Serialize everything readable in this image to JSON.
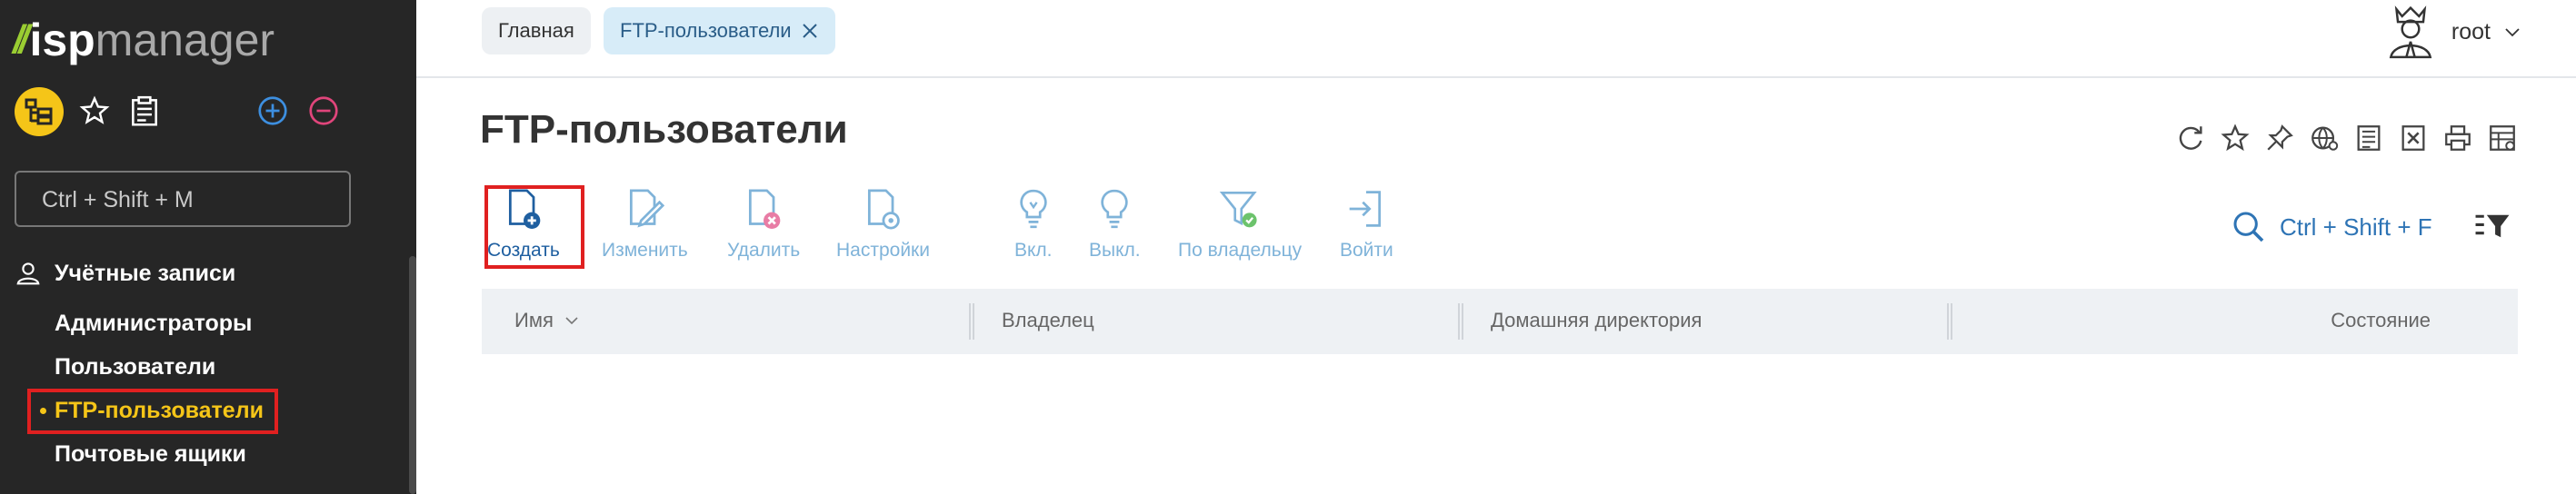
{
  "logo": {
    "part1": "isp",
    "part2": "manager"
  },
  "sidebar": {
    "search_placeholder": "Ctrl + Shift + M",
    "section_title": "Учётные записи",
    "items": [
      {
        "label": "Администраторы"
      },
      {
        "label": "Пользователи"
      },
      {
        "label": "FTP-пользователи",
        "active": true
      },
      {
        "label": "Почтовые ящики"
      }
    ]
  },
  "tabs": [
    {
      "label": "Главная"
    },
    {
      "label": "FTP-пользователи",
      "active": true
    }
  ],
  "user": {
    "name": "root"
  },
  "page": {
    "title": "FTP-пользователи"
  },
  "toolbar": {
    "create": "Создать",
    "edit": "Изменить",
    "delete": "Удалить",
    "settings": "Настройки",
    "on": "Вкл.",
    "off": "Выкл.",
    "by_owner": "По владельцу",
    "login": "Войти"
  },
  "search": {
    "hint": "Ctrl + Shift + F"
  },
  "table": {
    "columns": [
      "Имя",
      "Владелец",
      "Домашняя директория",
      "Состояние"
    ]
  },
  "colors": {
    "sidebar_bg": "#262626",
    "accent_yellow": "#f5c518",
    "link_blue": "#2e74b5",
    "highlight_red": "#e02020"
  }
}
